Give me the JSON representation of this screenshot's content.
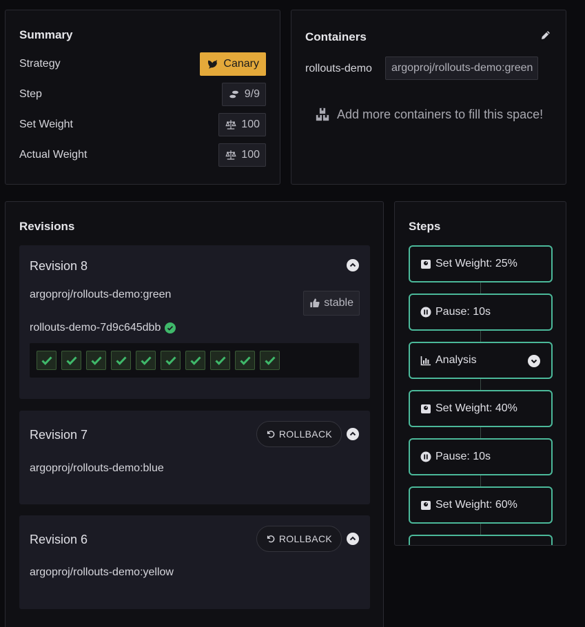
{
  "summary": {
    "title": "Summary",
    "strategy_label": "Strategy",
    "strategy_value": "Canary",
    "step_label": "Step",
    "step_value": "9/9",
    "set_weight_label": "Set Weight",
    "set_weight_value": "100",
    "actual_weight_label": "Actual Weight",
    "actual_weight_value": "100"
  },
  "containers": {
    "title": "Containers",
    "name": "rollouts-demo",
    "image": "argoproj/rollouts-demo:green",
    "add_hint": "Add more containers to fill this space!"
  },
  "revisions": {
    "title": "Revisions",
    "rollback_label": "ROLLBACK",
    "items": [
      {
        "title": "Revision 8",
        "image": "argoproj/rollouts-demo:green",
        "badge": "stable",
        "replicaset": "rollouts-demo-7d9c645dbb",
        "pod_count": 10
      },
      {
        "title": "Revision 7",
        "image": "argoproj/rollouts-demo:blue"
      },
      {
        "title": "Revision 6",
        "image": "argoproj/rollouts-demo:yellow"
      }
    ]
  },
  "steps": {
    "title": "Steps",
    "items": [
      {
        "label": "Set Weight: 25%",
        "icon": "weight-icon"
      },
      {
        "label": "Pause: 10s",
        "icon": "pause-icon"
      },
      {
        "label": "Analysis",
        "icon": "chart-icon"
      },
      {
        "label": "Set Weight: 40%",
        "icon": "weight-icon"
      },
      {
        "label": "Pause: 10s",
        "icon": "pause-icon"
      },
      {
        "label": "Set Weight: 60%",
        "icon": "weight-icon"
      }
    ]
  },
  "colors": {
    "canary": "#e4a93a",
    "step_border": "#4bb99a",
    "success": "#3fb86a"
  }
}
